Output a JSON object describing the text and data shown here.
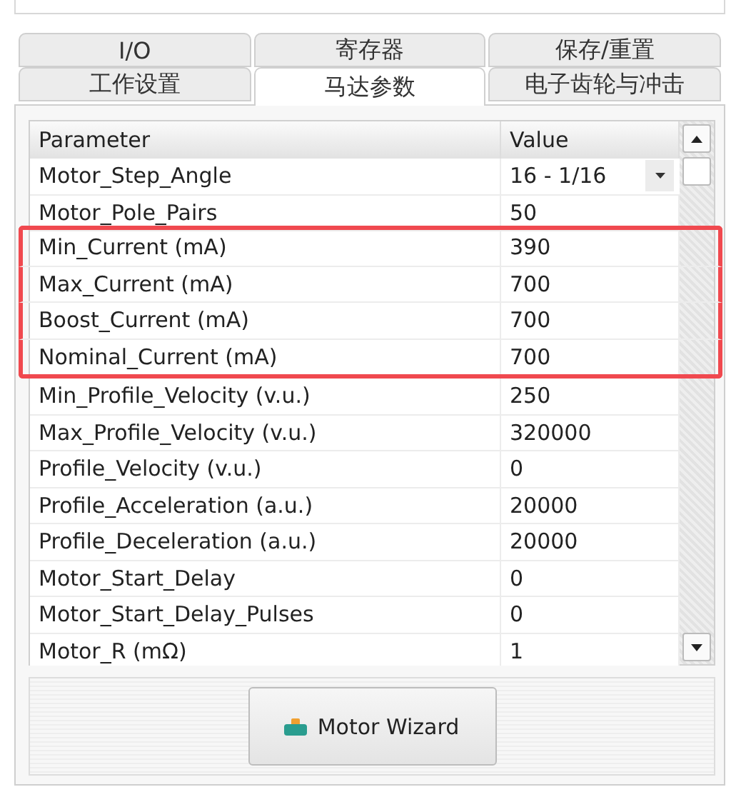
{
  "tab_rows": [
    [
      {
        "label": "I/O",
        "selected": false
      },
      {
        "label": "寄存器",
        "selected": false
      },
      {
        "label": "保存/重置",
        "selected": false
      }
    ],
    [
      {
        "label": "工作设置",
        "selected": false
      },
      {
        "label": "马达参数",
        "selected": true
      },
      {
        "label": "电子齿轮与冲击",
        "selected": false
      }
    ]
  ],
  "table": {
    "columns": [
      "Parameter",
      "Value"
    ],
    "rows": [
      {
        "parameter": "Motor_Step_Angle",
        "value": "16 - 1/16",
        "kind": "dropdown",
        "highlighted": false
      },
      {
        "parameter": "Motor_Pole_Pairs",
        "value": "50",
        "kind": "text",
        "highlighted": false
      },
      {
        "parameter": "Min_Current (mA)",
        "value": "390",
        "kind": "text",
        "highlighted": true
      },
      {
        "parameter": "Max_Current (mA)",
        "value": "700",
        "kind": "text",
        "highlighted": true
      },
      {
        "parameter": "Boost_Current (mA)",
        "value": "700",
        "kind": "text",
        "highlighted": true
      },
      {
        "parameter": "Nominal_Current (mA)",
        "value": "700",
        "kind": "text",
        "highlighted": true
      },
      {
        "parameter": "Min_Profile_Velocity (v.u.)",
        "value": "250",
        "kind": "text",
        "highlighted": false
      },
      {
        "parameter": "Max_Profile_Velocity (v.u.)",
        "value": "320000",
        "kind": "text",
        "highlighted": false
      },
      {
        "parameter": "Profile_Velocity (v.u.)",
        "value": "0",
        "kind": "text",
        "highlighted": false
      },
      {
        "parameter": "Profile_Acceleration (a.u.)",
        "value": "20000",
        "kind": "text",
        "highlighted": false
      },
      {
        "parameter": "Profile_Deceleration (a.u.)",
        "value": "20000",
        "kind": "text",
        "highlighted": false
      },
      {
        "parameter": "Motor_Start_Delay",
        "value": "0",
        "kind": "text",
        "highlighted": false
      },
      {
        "parameter": "Motor_Start_Delay_Pulses",
        "value": "0",
        "kind": "text",
        "highlighted": false
      },
      {
        "parameter": "Motor_R (mΩ)",
        "value": "1",
        "kind": "text",
        "highlighted": false
      }
    ]
  },
  "button": {
    "label": "Motor Wizard"
  }
}
